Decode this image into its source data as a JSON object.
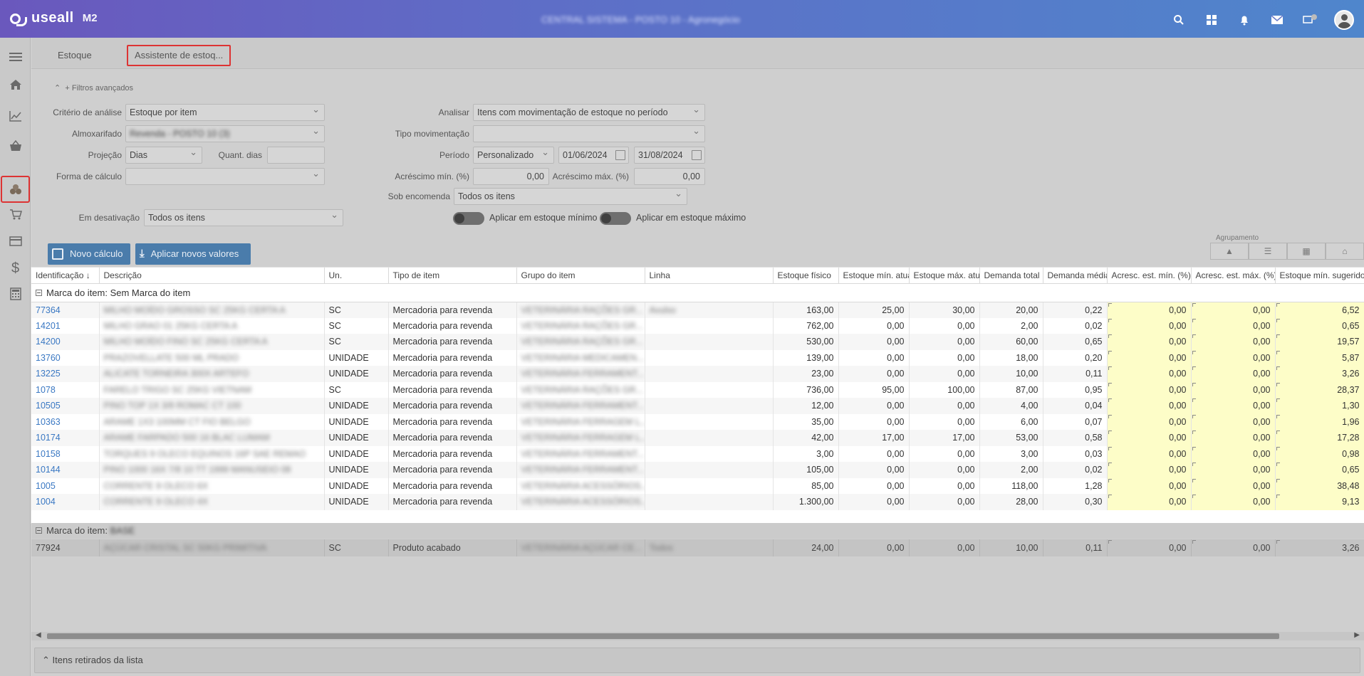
{
  "app": {
    "logo_text": "useall",
    "version": "M2",
    "context_title": "CENTRAL SISTEMA - POSTO 10 - Agronegócio"
  },
  "tabs": [
    {
      "label": "Estoque"
    },
    {
      "label": "Assistente de estoq..."
    }
  ],
  "filters": {
    "toggle_label": "Filtros avançados",
    "criterio_label": "Critério de análise",
    "criterio_value": "Estoque por item",
    "almoxarifado_label": "Almoxarifado",
    "almoxarifado_value": "Revenda - POSTO 10 (3)",
    "projecao_label": "Projeção",
    "projecao_value": "Dias",
    "quant_dias_label": "Quant. dias",
    "quant_dias_value": "",
    "forma_label": "Forma de cálculo",
    "forma_value": "",
    "desativacao_label": "Em desativação",
    "desativacao_value": "Todos os itens",
    "analisar_label": "Analisar",
    "analisar_value": "Itens com movimentação de estoque no período",
    "tipo_mov_label": "Tipo movimentação",
    "tipo_mov_value": "",
    "periodo_label": "Período",
    "periodo_value": "Personalizado",
    "data_inicio": "01/06/2024",
    "data_fim": "31/08/2024",
    "acresc_min_label": "Acréscimo mín. (%)",
    "acresc_min_value": "0,00",
    "acresc_max_label": "Acréscimo máx. (%)",
    "acresc_max_value": "0,00",
    "sob_encomenda_label": "Sob encomenda",
    "sob_encomenda_value": "Todos os itens",
    "toggle_min_label": "Aplicar em estoque mínimo",
    "toggle_max_label": "Aplicar em estoque máximo"
  },
  "actions": {
    "novo_calculo": "Novo cálculo",
    "aplicar": "Aplicar novos valores",
    "agrupamento_label": "Agrupamento"
  },
  "grid": {
    "columns": [
      "Identificação",
      "Descrição",
      "Un.",
      "Tipo de item",
      "Grupo do item",
      "Linha",
      "Estoque físico",
      "Estoque mín. atual",
      "Estoque máx. atual",
      "Demanda total",
      "Demanda média",
      "Acresc. est. mín. (%)",
      "Acresc. est. máx. (%)",
      "Estoque mín. sugerido"
    ],
    "group1_label": "Marca do item: Sem Marca do item",
    "rows": [
      {
        "id": "77364",
        "desc": "MILHO MOÍDO GROSSO SC 25KG CERTA A",
        "un": "SC",
        "tipo": "Mercadoria para revenda",
        "grupo": "VETERINÁRIA RAÇÕES GR...",
        "linha": "Avulso",
        "fis": "163,00",
        "min": "25,00",
        "max": "30,00",
        "dt": "20,00",
        "dm": "0,22",
        "amin": "0,00",
        "amax": "0,00",
        "sug": "6,52"
      },
      {
        "id": "14201",
        "desc": "MILHO GRAO 01 25KG CERTA A",
        "un": "SC",
        "tipo": "Mercadoria para revenda",
        "grupo": "VETERINÁRIA RAÇÕES GR...",
        "linha": "",
        "fis": "762,00",
        "min": "0,00",
        "max": "0,00",
        "dt": "2,00",
        "dm": "0,02",
        "amin": "0,00",
        "amax": "0,00",
        "sug": "0,65"
      },
      {
        "id": "14200",
        "desc": "MILHO MOÍDO FINO SC 25KG CERTA A",
        "un": "SC",
        "tipo": "Mercadoria para revenda",
        "grupo": "VETERINÁRIA RAÇÕES GR...",
        "linha": "",
        "fis": "530,00",
        "min": "0,00",
        "max": "0,00",
        "dt": "60,00",
        "dm": "0,65",
        "amin": "0,00",
        "amax": "0,00",
        "sug": "19,57"
      },
      {
        "id": "13760",
        "desc": "PRAZOVELLATE 500 ML PRADO",
        "un": "UNIDADE",
        "tipo": "Mercadoria para revenda",
        "grupo": "VETERINÁRIA MEDICAMEN...",
        "linha": "",
        "fis": "139,00",
        "min": "0,00",
        "max": "0,00",
        "dt": "18,00",
        "dm": "0,20",
        "amin": "0,00",
        "amax": "0,00",
        "sug": "5,87"
      },
      {
        "id": "13225",
        "desc": "ALICATE TORNEIRA 300X ARTEFO",
        "un": "UNIDADE",
        "tipo": "Mercadoria para revenda",
        "grupo": "VETERINÁRIA FERRAMENT...",
        "linha": "",
        "fis": "23,00",
        "min": "0,00",
        "max": "0,00",
        "dt": "10,00",
        "dm": "0,11",
        "amin": "0,00",
        "amax": "0,00",
        "sug": "3,26"
      },
      {
        "id": "1078",
        "desc": "FARELO TRIGO SC 25KG VIETNAM",
        "un": "SC",
        "tipo": "Mercadoria para revenda",
        "grupo": "VETERINÁRIA RAÇÕES GR...",
        "linha": "",
        "fis": "736,00",
        "min": "95,00",
        "max": "100,00",
        "dt": "87,00",
        "dm": "0,95",
        "amin": "0,00",
        "amax": "0,00",
        "sug": "28,37"
      },
      {
        "id": "10505",
        "desc": "PINO TOP 1X 3/8 ROMAC CT 100",
        "un": "UNIDADE",
        "tipo": "Mercadoria para revenda",
        "grupo": "VETERINÁRIA FERRAMENT...",
        "linha": "",
        "fis": "12,00",
        "min": "0,00",
        "max": "0,00",
        "dt": "4,00",
        "dm": "0,04",
        "amin": "0,00",
        "amax": "0,00",
        "sug": "1,30"
      },
      {
        "id": "10363",
        "desc": "ARAME 1X3 100MM CT FIO BELGO",
        "un": "UNIDADE",
        "tipo": "Mercadoria para revenda",
        "grupo": "VETERINÁRIA FERRAGEM L...",
        "linha": "",
        "fis": "35,00",
        "min": "0,00",
        "max": "0,00",
        "dt": "6,00",
        "dm": "0,07",
        "amin": "0,00",
        "amax": "0,00",
        "sug": "1,96"
      },
      {
        "id": "10174",
        "desc": "ARAME FARPADO 500 16 BLAC LUMAM",
        "un": "UNIDADE",
        "tipo": "Mercadoria para revenda",
        "grupo": "VETERINÁRIA FERRAGEM L...",
        "linha": "",
        "fis": "42,00",
        "min": "17,00",
        "max": "17,00",
        "dt": "53,00",
        "dm": "0,58",
        "amin": "0,00",
        "amax": "0,00",
        "sug": "17,28"
      },
      {
        "id": "10158",
        "desc": "TORQUES 9 OLECO EQUINOS 16P SAE REMAO",
        "un": "UNIDADE",
        "tipo": "Mercadoria para revenda",
        "grupo": "VETERINÁRIA FERRAMENT...",
        "linha": "",
        "fis": "3,00",
        "min": "0,00",
        "max": "0,00",
        "dt": "3,00",
        "dm": "0,03",
        "amin": "0,00",
        "amax": "0,00",
        "sug": "0,98"
      },
      {
        "id": "10144",
        "desc": "PINO 1000 16X 7/8 10 TT 1999 MANUSEIO 08",
        "un": "UNIDADE",
        "tipo": "Mercadoria para revenda",
        "grupo": "VETERINÁRIA FERRAMENT...",
        "linha": "",
        "fis": "105,00",
        "min": "0,00",
        "max": "0,00",
        "dt": "2,00",
        "dm": "0,02",
        "amin": "0,00",
        "amax": "0,00",
        "sug": "0,65"
      },
      {
        "id": "1005",
        "desc": "CORRENTE 9 OLECO 6X",
        "un": "UNIDADE",
        "tipo": "Mercadoria para revenda",
        "grupo": "VETERINÁRIA ACESSÓRIOS...",
        "linha": "",
        "fis": "85,00",
        "min": "0,00",
        "max": "0,00",
        "dt": "118,00",
        "dm": "1,28",
        "amin": "0,00",
        "amax": "0,00",
        "sug": "38,48"
      },
      {
        "id": "1004",
        "desc": "CORRENTE 9 OLECO 4X",
        "un": "UNIDADE",
        "tipo": "Mercadoria para revenda",
        "grupo": "VETERINÁRIA ACESSÓRIOS...",
        "linha": "",
        "fis": "1.300,00",
        "min": "0,00",
        "max": "0,00",
        "dt": "28,00",
        "dm": "0,30",
        "amin": "0,00",
        "amax": "0,00",
        "sug": "9,13"
      }
    ],
    "group2_label": "Marca do item:",
    "group2_value": "BASE",
    "row2": {
      "id": "77924",
      "desc": "AÇÚCAR CRISTAL SC 50KG PRIMITIVA",
      "un": "SC",
      "tipo": "Produto acabado",
      "grupo": "VETERINÁRIA AÇÚCAR CE...",
      "linha": "Todos",
      "fis": "24,00",
      "min": "0,00",
      "max": "0,00",
      "dt": "10,00",
      "dm": "0,11",
      "amin": "0,00",
      "amax": "0,00",
      "sug": "3,26"
    }
  },
  "footer": {
    "label": "Itens retirados da lista"
  }
}
